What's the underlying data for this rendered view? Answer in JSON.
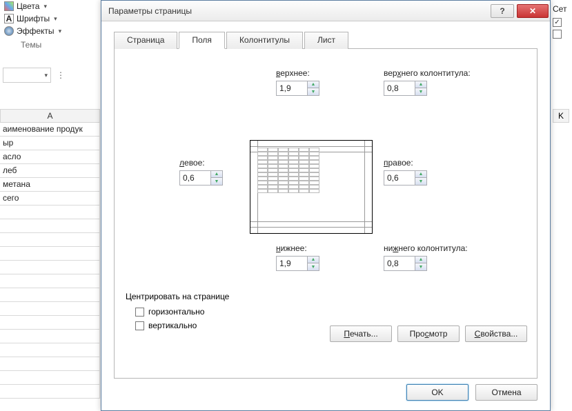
{
  "ribbon": {
    "colors": "Цвета",
    "fonts": "Шрифты",
    "effects": "Эффекты",
    "themes": "Темы"
  },
  "col_a": "A",
  "col_k": "K",
  "cells": [
    "аименование продук",
    "ыр",
    "асло",
    "леб",
    "метана",
    "сего"
  ],
  "right": {
    "gridlines": "Сет",
    "chk1_checked": "✓"
  },
  "dialog": {
    "title": "Параметры страницы",
    "tabs": {
      "page": "Страница",
      "margins": "Поля",
      "headers": "Колонтитулы",
      "sheet": "Лист"
    },
    "labels": {
      "top": "верхнее:",
      "top_u": "в",
      "header": "верхнего колонтитула:",
      "header_u": "х",
      "left": "левое:",
      "left_u": "л",
      "right": "правое:",
      "right_u": "п",
      "bottom": "нижнее:",
      "bottom_u": "н",
      "footer": "нижнего колонтитула:",
      "footer_u": "ж",
      "center": "Центрировать на странице",
      "horiz": "горизонтально",
      "horiz_u": "г",
      "vert": "вертикально",
      "vert_u": "в"
    },
    "values": {
      "top": "1,9",
      "header": "0,8",
      "left": "0,6",
      "right": "0,6",
      "bottom": "1,9",
      "footer": "0,8"
    },
    "buttons": {
      "print": "Печать...",
      "print_u": "П",
      "preview": "Просмотр",
      "preview_u": "с",
      "props": "Свойства...",
      "props_u": "С",
      "ok": "OK",
      "cancel": "Отмена"
    }
  }
}
